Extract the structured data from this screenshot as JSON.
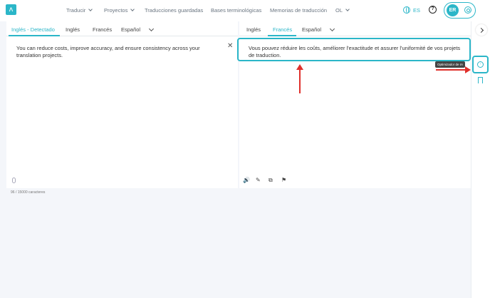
{
  "app": {
    "logo_glyph": "ʌ"
  },
  "nav": {
    "items": [
      {
        "label": "Traducir",
        "dropdown": true
      },
      {
        "label": "Proyectos",
        "dropdown": true
      },
      {
        "label": "Traducciones guardadas",
        "dropdown": false
      },
      {
        "label": "Bases terminológicas",
        "dropdown": false
      },
      {
        "label": "Memorias de traducción",
        "dropdown": false
      },
      {
        "label": "OL",
        "dropdown": true
      }
    ],
    "language": "ES",
    "help_glyph": "?",
    "user_initials": "ER"
  },
  "source": {
    "tabs": [
      "Inglés - Detectado",
      "Inglés",
      "Francés",
      "Español"
    ],
    "active_tab": 0,
    "text": "You can reduce costs, improve accuracy, and ensure consistency across your translation projects.",
    "counter": "96 / 15000 caracteres"
  },
  "target": {
    "tabs": [
      "Inglés",
      "Francés",
      "Español"
    ],
    "active_tab": 1,
    "text": "Vous pouvez réduire les coûts, améliorer l'exactitude et assurer l'uniformité de vos projets de traduction."
  },
  "rail": {
    "tooltip": "Optimizador de IA"
  },
  "colors": {
    "accent": "#2bb6c8",
    "annotation": "#e0302b"
  }
}
